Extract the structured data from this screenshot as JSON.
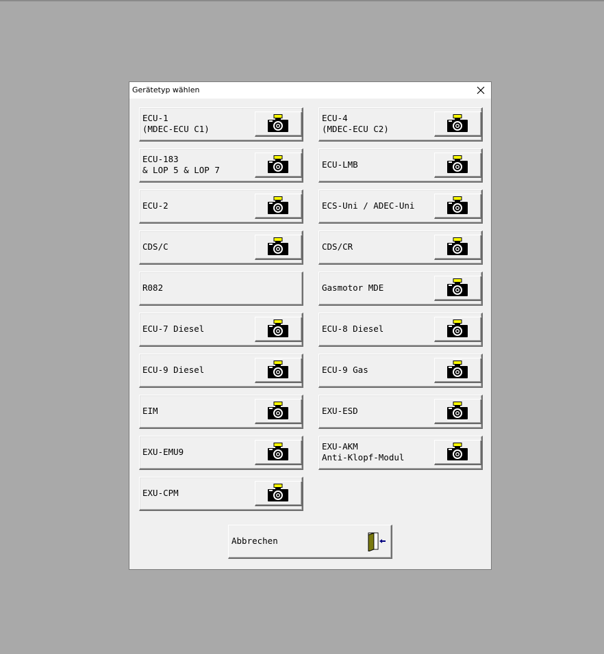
{
  "dialog": {
    "title": "Gerätetyp wählen",
    "close_icon": "close-icon"
  },
  "devices": [
    {
      "label": "ECU-1\n(MDEC-ECU C1)",
      "camera": true
    },
    {
      "label": "ECU-4\n(MDEC-ECU C2)",
      "camera": true
    },
    {
      "label": "ECU-183\n& LOP 5 & LOP 7",
      "camera": true
    },
    {
      "label": "ECU-LMB",
      "camera": true
    },
    {
      "label": "ECU-2",
      "camera": true
    },
    {
      "label": "ECS-Uni / ADEC-Uni",
      "camera": true
    },
    {
      "label": "CDS/C",
      "camera": true
    },
    {
      "label": "CDS/CR",
      "camera": true
    },
    {
      "label": "R082",
      "camera": false
    },
    {
      "label": "Gasmotor MDE",
      "camera": true
    },
    {
      "label": "ECU-7 Diesel",
      "camera": true
    },
    {
      "label": "ECU-8 Diesel",
      "camera": true
    },
    {
      "label": "ECU-9 Diesel",
      "camera": true
    },
    {
      "label": "ECU-9 Gas",
      "camera": true
    },
    {
      "label": "EIM",
      "camera": true
    },
    {
      "label": "EXU-ESD",
      "camera": true
    },
    {
      "label": "EXU-EMU9",
      "camera": true
    },
    {
      "label": "EXU-AKM\nAnti-Klopf-Modul",
      "camera": true
    },
    {
      "label": "EXU-CPM",
      "camera": true
    }
  ],
  "cancel": {
    "label": "Abbrechen",
    "icon": "exit-door-icon"
  },
  "colors": {
    "desktop": "#a9a9a9",
    "dialog_bg": "#f0f0f0",
    "door_green": "#7a7a10",
    "arrow_blue": "#000080"
  }
}
